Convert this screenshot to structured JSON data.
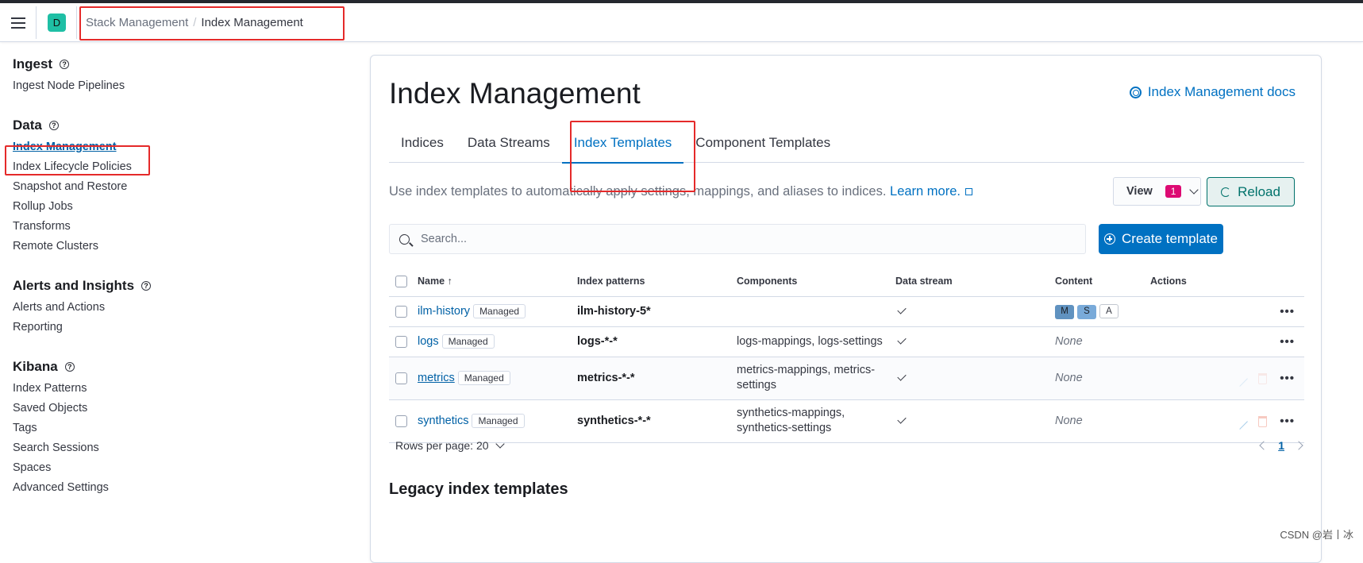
{
  "header": {
    "space_initial": "D",
    "breadcrumbs": [
      "Stack Management",
      "Index Management"
    ]
  },
  "sidebar": {
    "groups": [
      {
        "title": "Ingest",
        "items": [
          "Ingest Node Pipelines"
        ]
      },
      {
        "title": "Data",
        "items": [
          "Index Management",
          "Index Lifecycle Policies",
          "Snapshot and Restore",
          "Rollup Jobs",
          "Transforms",
          "Remote Clusters"
        ]
      },
      {
        "title": "Alerts and Insights",
        "items": [
          "Alerts and Actions",
          "Reporting"
        ]
      },
      {
        "title": "Kibana",
        "items": [
          "Index Patterns",
          "Saved Objects",
          "Tags",
          "Search Sessions",
          "Spaces",
          "Advanced Settings"
        ]
      }
    ],
    "active_item": "Index Management",
    "help_glyph": "?"
  },
  "main": {
    "title": "Index Management",
    "docs_link": "Index Management docs",
    "tabs": [
      "Indices",
      "Data Streams",
      "Index Templates",
      "Component Templates"
    ],
    "selected_tab": "Index Templates",
    "description": "Use index templates to automatically apply settings, mappings, and aliases to indices.",
    "learn_more": "Learn more.",
    "view_label": "View",
    "view_count": "1",
    "reload_label": "Reload",
    "search_placeholder": "Search...",
    "create_label": "Create template",
    "table": {
      "headers": [
        "Name",
        "Index patterns",
        "Components",
        "Data stream",
        "Content",
        "Actions"
      ],
      "sort_glyph": "↑",
      "rows": [
        {
          "name": "ilm-history",
          "badge": "Managed",
          "pattern": "ilm-history-5*",
          "components": "",
          "data_stream": true,
          "content": [
            "M",
            "S",
            "A"
          ]
        },
        {
          "name": "logs",
          "badge": "Managed",
          "pattern": "logs-*-*",
          "components": "logs-mappings, logs-settings",
          "data_stream": true,
          "content": "None"
        },
        {
          "name": "metrics",
          "badge": "Managed",
          "pattern": "metrics-*-*",
          "components": "metrics-mappings, metrics-settings",
          "data_stream": true,
          "content": "None"
        },
        {
          "name": "synthetics",
          "badge": "Managed",
          "pattern": "synthetics-*-*",
          "components": "synthetics-mappings, synthetics-settings",
          "data_stream": true,
          "content": "None"
        }
      ],
      "actions_glyph": "•••"
    },
    "rows_per_page": "Rows per page: 20",
    "current_page": "1",
    "legacy_title": "Legacy index templates"
  },
  "colors": {
    "accent": "#0071c2",
    "annotation": "#e52a2a",
    "badge": "#dd0a73",
    "reload": "#00726b"
  },
  "watermark": "CSDN @岩丨冰"
}
